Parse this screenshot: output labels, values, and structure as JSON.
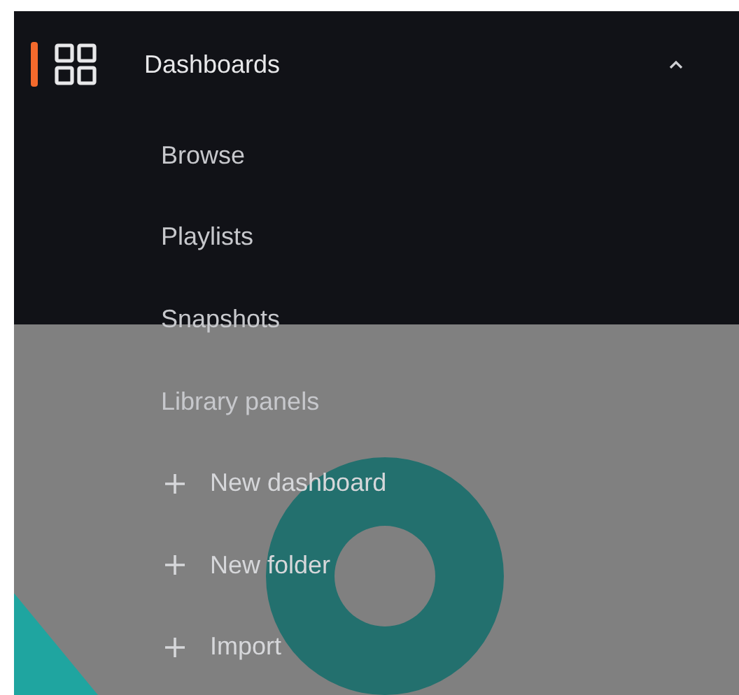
{
  "section": {
    "title": "Dashboards",
    "expanded": true,
    "selected": true
  },
  "items": [
    {
      "label": "Browse",
      "kind": "link"
    },
    {
      "label": "Playlists",
      "kind": "link"
    },
    {
      "label": "Snapshots",
      "kind": "link"
    },
    {
      "label": "Library panels",
      "kind": "link"
    },
    {
      "label": "New dashboard",
      "kind": "action"
    },
    {
      "label": "New folder",
      "kind": "action"
    },
    {
      "label": "Import",
      "kind": "action"
    }
  ]
}
